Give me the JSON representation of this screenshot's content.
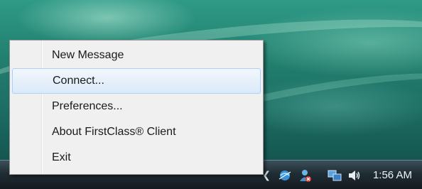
{
  "menu": {
    "items": [
      {
        "label": "New Message"
      },
      {
        "label": "Connect..."
      },
      {
        "label": "Preferences..."
      },
      {
        "label": "About FirstClass® Client"
      },
      {
        "label": "Exit"
      }
    ]
  },
  "tray": {
    "clock": "1:56 AM",
    "icons": [
      "show-hidden-icons-arrow",
      "network-icon",
      "messenger-icon",
      "network-connection-icon",
      "volume-icon"
    ]
  },
  "colors": {
    "menu_background": "#f0f0f0",
    "menu_hover": "#dbe9f8",
    "taskbar": "#1f2c33",
    "desktop": "#22806f"
  }
}
